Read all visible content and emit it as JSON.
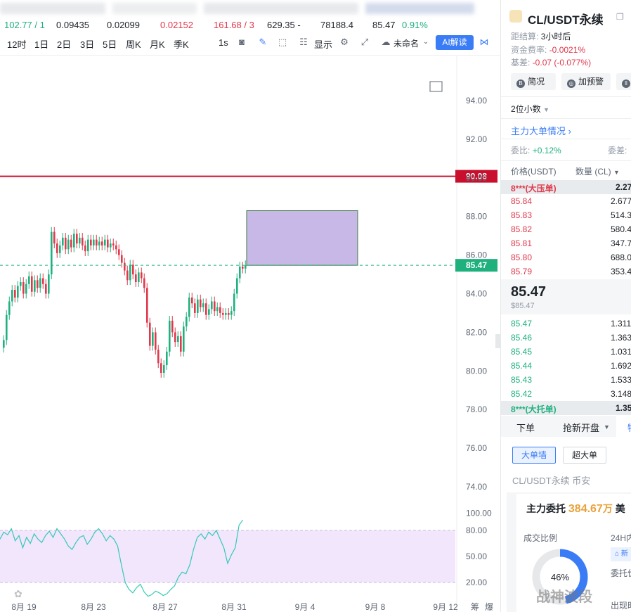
{
  "ticker_stats": [
    "102.77 / 1",
    "0.09435",
    "0.02099",
    "0.02152",
    "161.68 / 3",
    "629.35 -",
    "78188.4",
    "85.47",
    "0.91%"
  ],
  "toolbar": {
    "intervals": [
      "12时",
      "1日",
      "2日",
      "3日",
      "5日",
      "周K",
      "月K",
      "季K"
    ],
    "interval_1s": "1s",
    "display_label": "显示",
    "unnamed_label": "未命名",
    "ai_label": "AI解读"
  },
  "chart": {
    "price_axis": [
      "94.00",
      "92.00",
      "90.00",
      "88.00",
      "86.00",
      "84.00",
      "82.00",
      "80.00",
      "78.00",
      "76.00",
      "74.00"
    ],
    "osc_axis": [
      "100.00",
      "80.00",
      "50.00",
      "20.00"
    ],
    "date_axis": [
      "8月 19",
      "8月 23",
      "8月 27",
      "8月 31",
      "9月 4",
      "9月 8",
      "9月 12"
    ],
    "bottom_right_a": "筹",
    "bottom_right_b": "爆",
    "resistance_label": "90.08",
    "resistance_value": 90.08,
    "last_price_label": "85.47",
    "last_price_value": 85.47,
    "box_top_value": 88.3,
    "box_bottom_value": 85.47,
    "colors": {
      "up": "#1eb17e",
      "down": "#e0384b",
      "box_fill": "#c8b8e8",
      "osc_band": "#f1e6fb",
      "osc_line": "#35c9b7"
    }
  },
  "right": {
    "symbol": "CL/USDT永续",
    "settle_label": "距结算:",
    "settle_value": "3小时后",
    "funding_label": "资金费率:",
    "funding_value": "-0.0021%",
    "basis_label": "基差:",
    "basis_value": "-0.07 (-0.077%)",
    "buttons": [
      "简况",
      "加预警",
      ""
    ],
    "decimals": "2位小数",
    "main_order": "主力大单情况",
    "ratio_label": "委比:",
    "ratio_value": "+0.12%",
    "diff_label": "委差:",
    "col_price": "价格(USDT)",
    "col_qty": "数量 (CL)",
    "big_ask_label": "8***(大压单)",
    "big_ask_qty": "2.27",
    "asks": [
      {
        "p": "85.84",
        "q": "2.677"
      },
      {
        "p": "85.83",
        "q": "514.3"
      },
      {
        "p": "85.82",
        "q": "580.4"
      },
      {
        "p": "85.81",
        "q": "347.7"
      },
      {
        "p": "85.80",
        "q": "688.0"
      },
      {
        "p": "85.79",
        "q": "353.4"
      }
    ],
    "last": "85.47",
    "last_usd": "$85.47",
    "bids": [
      {
        "p": "85.47",
        "q": "1.311"
      },
      {
        "p": "85.46",
        "q": "1.363"
      },
      {
        "p": "85.45",
        "q": "1.031"
      },
      {
        "p": "85.44",
        "q": "1.692"
      },
      {
        "p": "85.43",
        "q": "1.533"
      },
      {
        "p": "85.42",
        "q": "3.148"
      }
    ],
    "big_bid_label": "8***(大托单)",
    "big_bid_qty": "1.35",
    "tab_order": "下单",
    "tab_open": "抢新开盘",
    "tab_more": "特",
    "wall_btn": "大单墙",
    "big_btn": "超大单",
    "pair_exchange": "CL/USDT永续 币安",
    "main_commission_label": "主力委托",
    "main_commission_value": "384.67",
    "main_commission_unit": "万",
    "main_commission_ccy": "美",
    "deal_ratio_label": "成交比例",
    "h24_label": "24H内",
    "donut_pct": "46%",
    "donut_value": 46,
    "commission_price": "委托价",
    "appear_time": "出现时",
    "watermark": "战神波段"
  }
}
